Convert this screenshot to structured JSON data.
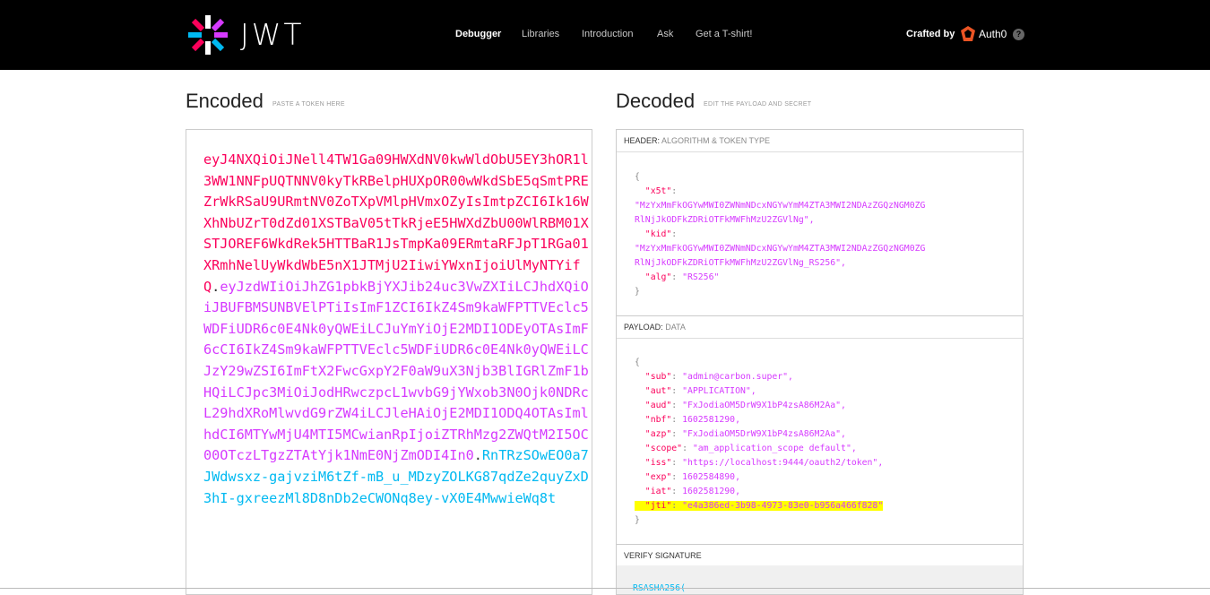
{
  "header": {
    "logo_text": "JWT",
    "nav": [
      {
        "label": "Debugger",
        "active": true
      },
      {
        "label": "Libraries",
        "active": false
      },
      {
        "label": "Introduction",
        "active": false
      },
      {
        "label": "Ask",
        "active": false
      },
      {
        "label": "Get a T-shirt!",
        "active": false
      }
    ],
    "crafted_by": "Crafted by",
    "brand": "Auth0",
    "help": "?"
  },
  "encoded": {
    "title": "Encoded",
    "subtitle": "PASTE A TOKEN HERE",
    "token_header": "eyJ4NXQiOiJNell4TW1Ga09HWXdNV0kwWldObU5EY3hOR1l3WW1NNFpUQTNNV0kyTkRBelpHUXpOR00wWkdSbE5qSmtPREZrWkRSaU9URmtNV0ZoTXpVMlpHVmxOZyIsImtpZCI6Ik16WXhNbUZrT0dZd01XSTBaV05tTkRjeE5HWXdZbU00WlRBM01XSTJOREF6WkdRek5HTTBaR1JsTmpKa09ERmtaRFJpT1RGa01XRmhNelUyWkdWbE5nX1JTMjU2IiwiYWxnIjoiUlMyNTYifQ",
    "dot": ".",
    "token_payload": "eyJzdWIiOiJhZG1pbkBjYXJib24uc3VwZXIiLCJhdXQiOiJBUFBMSUNBVElPTiIsImF1ZCI6IkZ4Sm9kaWFPTTVEclc5WDFiUDR6c0E4Nk0yQWEiLCJuYmYiOjE2MDI1ODEyOTAsImF6cCI6IkZ4Sm9kaWFPTTVEclc5WDFiUDR6c0E4Nk0yQWEiLCJzY29wZSI6ImFtX2FwcGxpY2F0aW9uX3Njb3BlIGRlZmF1bHQiLCJpc3MiOiJodHRwczpcL1wvbG9jYWxob3N0Ojk0NDRcL29hdXRoMlwvdG9rZW4iLCJleHAiOjE2MDI1ODQ4OTAsImlhdCI6MTYwMjU4MTI5MCwianRpIjoiZTRhMzg2ZWQtM2I5OC00OTczLTgzZTAtYjk1NmE0NjZmODI4In0",
    "token_signature": "RnTRzSOwEO0a7JWdwsxz-gajvziM6tZf-mB_u_MDzyZOLKG87qdZe2quyZxD3hI-gxreezMl8D8nDb2eCWONq8ey-vX0E4MwwieWq8t"
  },
  "decoded": {
    "title": "Decoded",
    "subtitle": "EDIT THE PAYLOAD AND SECRET",
    "header_section": {
      "label": "HEADER:",
      "sub": "ALGORITHM & TOKEN TYPE"
    },
    "payload_section": {
      "label": "PAYLOAD:",
      "sub": "DATA"
    },
    "signature_section": {
      "label": "VERIFY SIGNATURE",
      "preview": "RSASHA256("
    },
    "header_json": {
      "open": "{",
      "x5t_key": "\"x5t\"",
      "x5t_val1": "\"MzYxMmFkOGYwMWI0ZWNmNDcxNGYwYmM4ZTA3MWI2NDAzZGQzNGM0ZG",
      "x5t_val2": "RlNjJkODFkZDRiOTFkMWFhMzU2ZGVlNg\",",
      "kid_key": "\"kid\"",
      "kid_val1": "\"MzYxMmFkOGYwMWI0ZWNmNDcxNGYwYmM4ZTA3MWI2NDAzZGQzNGM0ZG",
      "kid_val2": "RlNjJkODFkZDRiOTFkMWFhMzU2ZGVlNg_RS256\",",
      "alg_key": "\"alg\"",
      "alg_val": "\"RS256\"",
      "close": "}"
    },
    "payload_json": [
      {
        "key": "\"sub\"",
        "val": "\"admin@carbon.super\","
      },
      {
        "key": "\"aut\"",
        "val": "\"APPLICATION\","
      },
      {
        "key": "\"aud\"",
        "val": "\"FxJodiaOM5DrW9X1bP4zsA86M2Aa\","
      },
      {
        "key": "\"nbf\"",
        "val": "1602581290,"
      },
      {
        "key": "\"azp\"",
        "val": "\"FxJodiaOM5DrW9X1bP4zsA86M2Aa\","
      },
      {
        "key": "\"scope\"",
        "val": "\"am_application_scope default\","
      },
      {
        "key": "\"iss\"",
        "val": "\"https://localhost:9444/oauth2/token\","
      },
      {
        "key": "\"exp\"",
        "val": "1602584890,"
      },
      {
        "key": "\"iat\"",
        "val": "1602581290,"
      },
      {
        "key": "\"jti\"",
        "val": "\"e4a386ed-3b98-4973-83e0-b956a466f828\""
      }
    ],
    "payload_open": "{",
    "payload_close": "}"
  },
  "colors": {
    "header_part": "#fb015b",
    "payload_part": "#d63aff",
    "signature_part": "#00b9f1",
    "highlight": "#ffff00"
  }
}
